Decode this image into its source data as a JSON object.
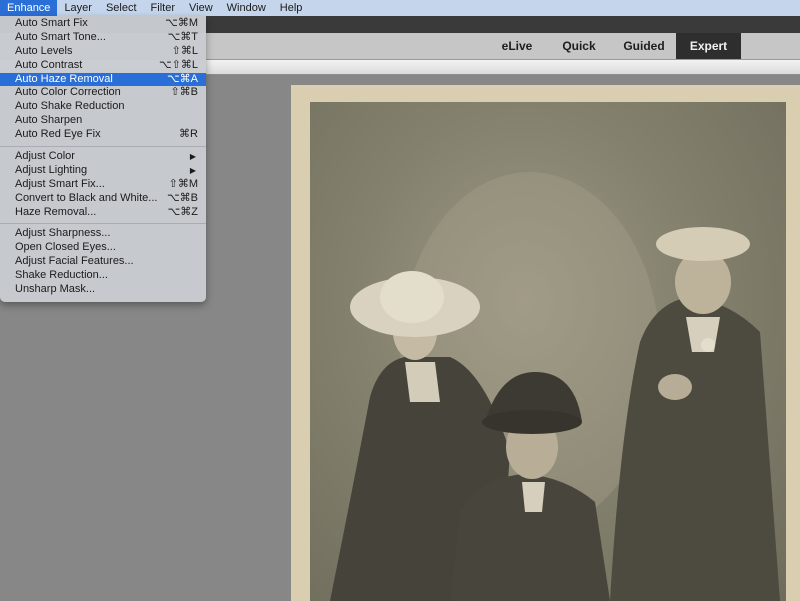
{
  "menubar": {
    "items": [
      "Enhance",
      "Layer",
      "Select",
      "Filter",
      "View",
      "Window",
      "Help"
    ],
    "active": "Enhance"
  },
  "modes": {
    "tabs": [
      "eLive",
      "Quick",
      "Guided",
      "Expert"
    ],
    "active": "Expert"
  },
  "enhance_menu": {
    "group1": [
      {
        "label": "Auto Smart Fix",
        "shortcut": "⌥⌘M"
      },
      {
        "label": "Auto Smart Tone...",
        "shortcut": "⌥⌘T"
      },
      {
        "label": "Auto Levels",
        "shortcut": "⇧⌘L"
      },
      {
        "label": "Auto Contrast",
        "shortcut": "⌥⇧⌘L"
      },
      {
        "label": "Auto Haze Removal",
        "shortcut": "⌥⌘A",
        "highlighted": true
      },
      {
        "label": "Auto Color Correction",
        "shortcut": "⇧⌘B"
      },
      {
        "label": "Auto Shake Reduction",
        "shortcut": ""
      },
      {
        "label": "Auto Sharpen",
        "shortcut": ""
      },
      {
        "label": "Auto Red Eye Fix",
        "shortcut": "⌘R"
      }
    ],
    "group2": [
      {
        "label": "Adjust Color",
        "submenu": true,
        "arrow": "▶"
      },
      {
        "label": "Adjust Lighting",
        "submenu": true,
        "arrow": "▶"
      },
      {
        "label": "Adjust Smart Fix...",
        "shortcut": "⇧⌘M"
      },
      {
        "label": "Convert to Black and White...",
        "shortcut": "⌥⌘B"
      },
      {
        "label": "Haze Removal...",
        "shortcut": "⌥⌘Z"
      }
    ],
    "group3": [
      {
        "label": "Adjust Sharpness..."
      },
      {
        "label": "Open Closed Eyes..."
      },
      {
        "label": "Adjust Facial Features..."
      },
      {
        "label": "Shake Reduction..."
      },
      {
        "label": "Unsharp Mask..."
      }
    ]
  },
  "document": {
    "description": "Vintage sepia family portrait photograph with three people"
  },
  "colors": {
    "menu_highlight": "#2a6fd8",
    "menubar_bg": "#c5d6ec",
    "active_mode_bg": "#2e2e2e",
    "canvas_bg": "#878787"
  }
}
